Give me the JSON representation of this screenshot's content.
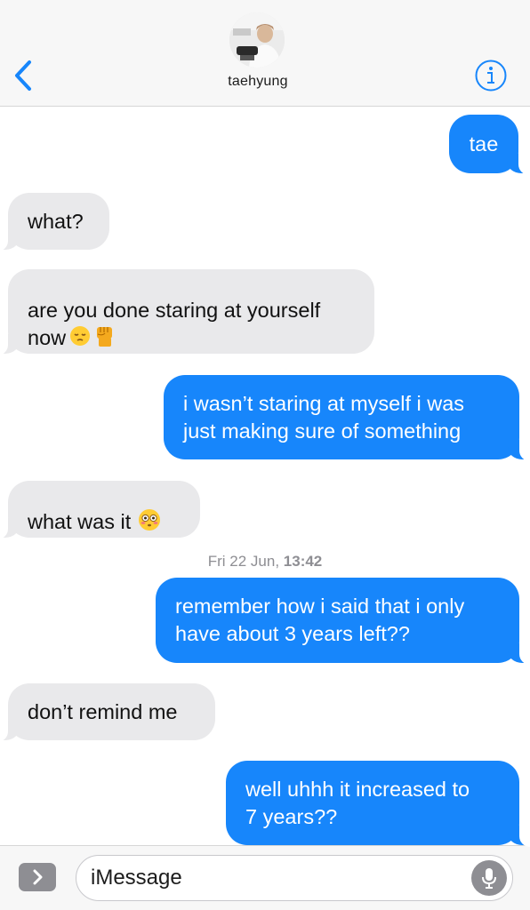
{
  "header": {
    "contact_name": "taehyung",
    "back_icon": "chevron-left-icon",
    "info_icon": "info-icon",
    "accent_color": "#1786fb"
  },
  "messages": [
    {
      "direction": "sent",
      "text": "tae"
    },
    {
      "direction": "received",
      "text": "what?"
    },
    {
      "direction": "received",
      "text": "are you done staring at yourself\nnow",
      "emoji": [
        "pensive-face",
        "raised-fist"
      ]
    },
    {
      "direction": "sent",
      "text": "i wasn’t staring at myself i was\njust making sure of something"
    },
    {
      "direction": "received",
      "text": "what was it",
      "emoji": [
        "flushed-face"
      ]
    },
    {
      "direction": "sent",
      "text": "remember how i said that i only\nhave about 3 years left??"
    },
    {
      "direction": "received",
      "text": "don’t remind me"
    },
    {
      "direction": "sent",
      "text": "well uhhh it increased to\n7 years??"
    }
  ],
  "timestamp": {
    "day": "Fri 22 Jun,",
    "time": "13:42"
  },
  "input": {
    "placeholder": "iMessage",
    "apps_icon": "chevron-right-icon",
    "mic_icon": "microphone-icon"
  },
  "colors": {
    "sent_bubble": "#1786fb",
    "received_bubble": "#e9e9eb",
    "header_bg": "#f7f7f7"
  }
}
